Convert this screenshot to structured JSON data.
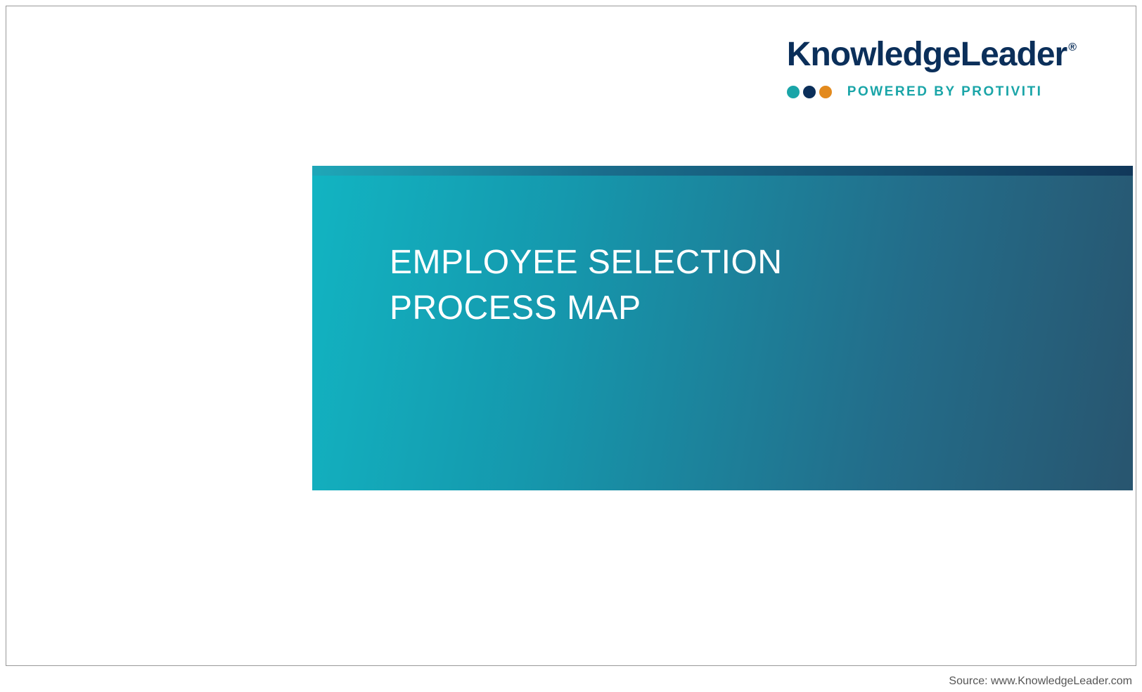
{
  "logo": {
    "brand": "KnowledgeLeader",
    "registered": "®",
    "tagline": "POWERED BY PROTIVITI"
  },
  "title": {
    "line1": "EMPLOYEE SELECTION",
    "line2": "PROCESS MAP"
  },
  "footer": {
    "source": "Source: www.KnowledgeLeader.com"
  }
}
